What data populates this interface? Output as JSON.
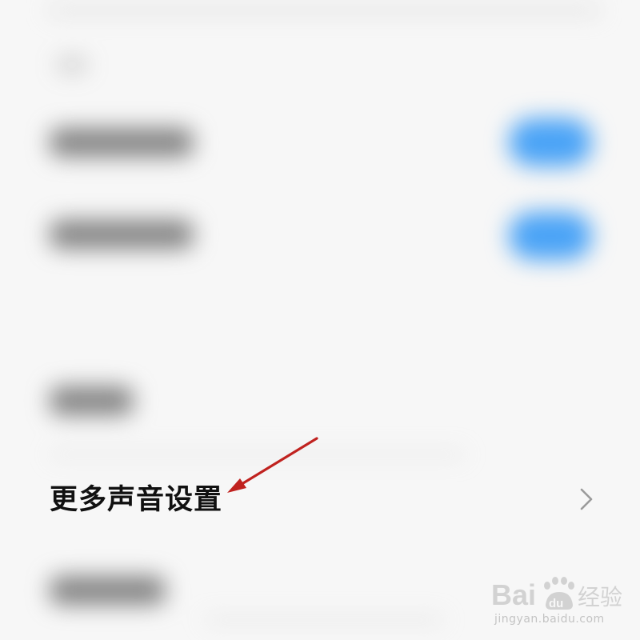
{
  "settings": {
    "more_sound_settings": {
      "label": "更多声音设置",
      "icon": "chevron-right-icon"
    }
  },
  "annotation": {
    "arrow_color": "#c0221f"
  },
  "watermark": {
    "logo_text": "Baidu 经验",
    "url": "jingyan.baidu.com"
  },
  "colors": {
    "toggle_on": "#4aa3f6",
    "background": "#f7f7f7",
    "text": "#111111"
  }
}
